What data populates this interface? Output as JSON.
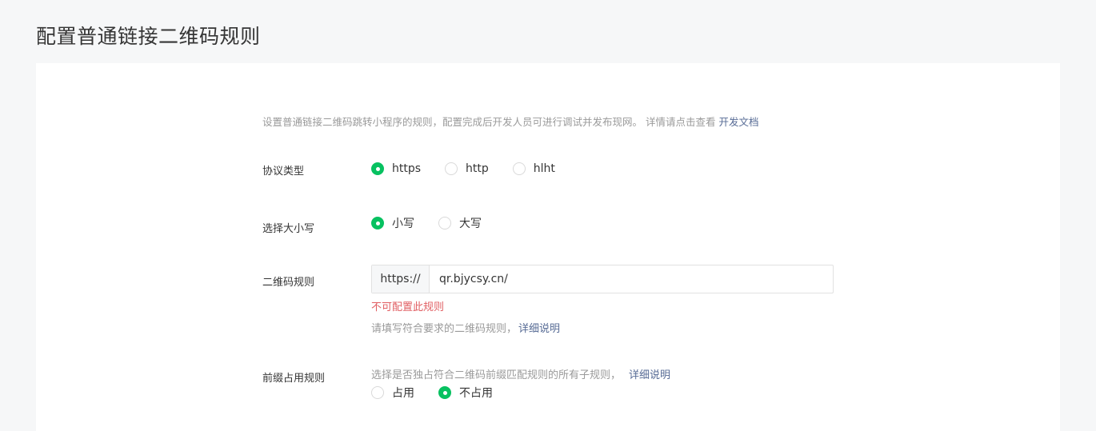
{
  "page": {
    "title": "配置普通链接二维码规则"
  },
  "intro": {
    "text": "设置普通链接二维码跳转小程序的规则，配置完成后开发人员可进行调试并发布现网。 详情请点击查看",
    "link": "开发文档"
  },
  "protocol": {
    "label": "协议类型",
    "options": [
      "https",
      "http",
      "hlht"
    ],
    "selected": "https"
  },
  "case": {
    "label": "选择大小写",
    "options": [
      "小写",
      "大写"
    ],
    "selected": "小写"
  },
  "qr_rule": {
    "label": "二维码规则",
    "prefix": "https://",
    "value": "qr.bjycsy.cn/",
    "error": "不可配置此规则",
    "tip": "请填写符合要求的二维码规则，",
    "tip_link": "详细说明"
  },
  "prefix_rule": {
    "label": "前缀占用规则",
    "tip": "选择是否独占符合二维码前缀匹配规则的所有子规则，",
    "tip_link": "详细说明",
    "options": [
      "占用",
      "不占用"
    ],
    "selected": "不占用"
  },
  "colors": {
    "accent": "#07c160",
    "link": "#576b95",
    "error": "#e15f63",
    "muted": "#9a9a9a",
    "background": "#f6f7f8"
  }
}
